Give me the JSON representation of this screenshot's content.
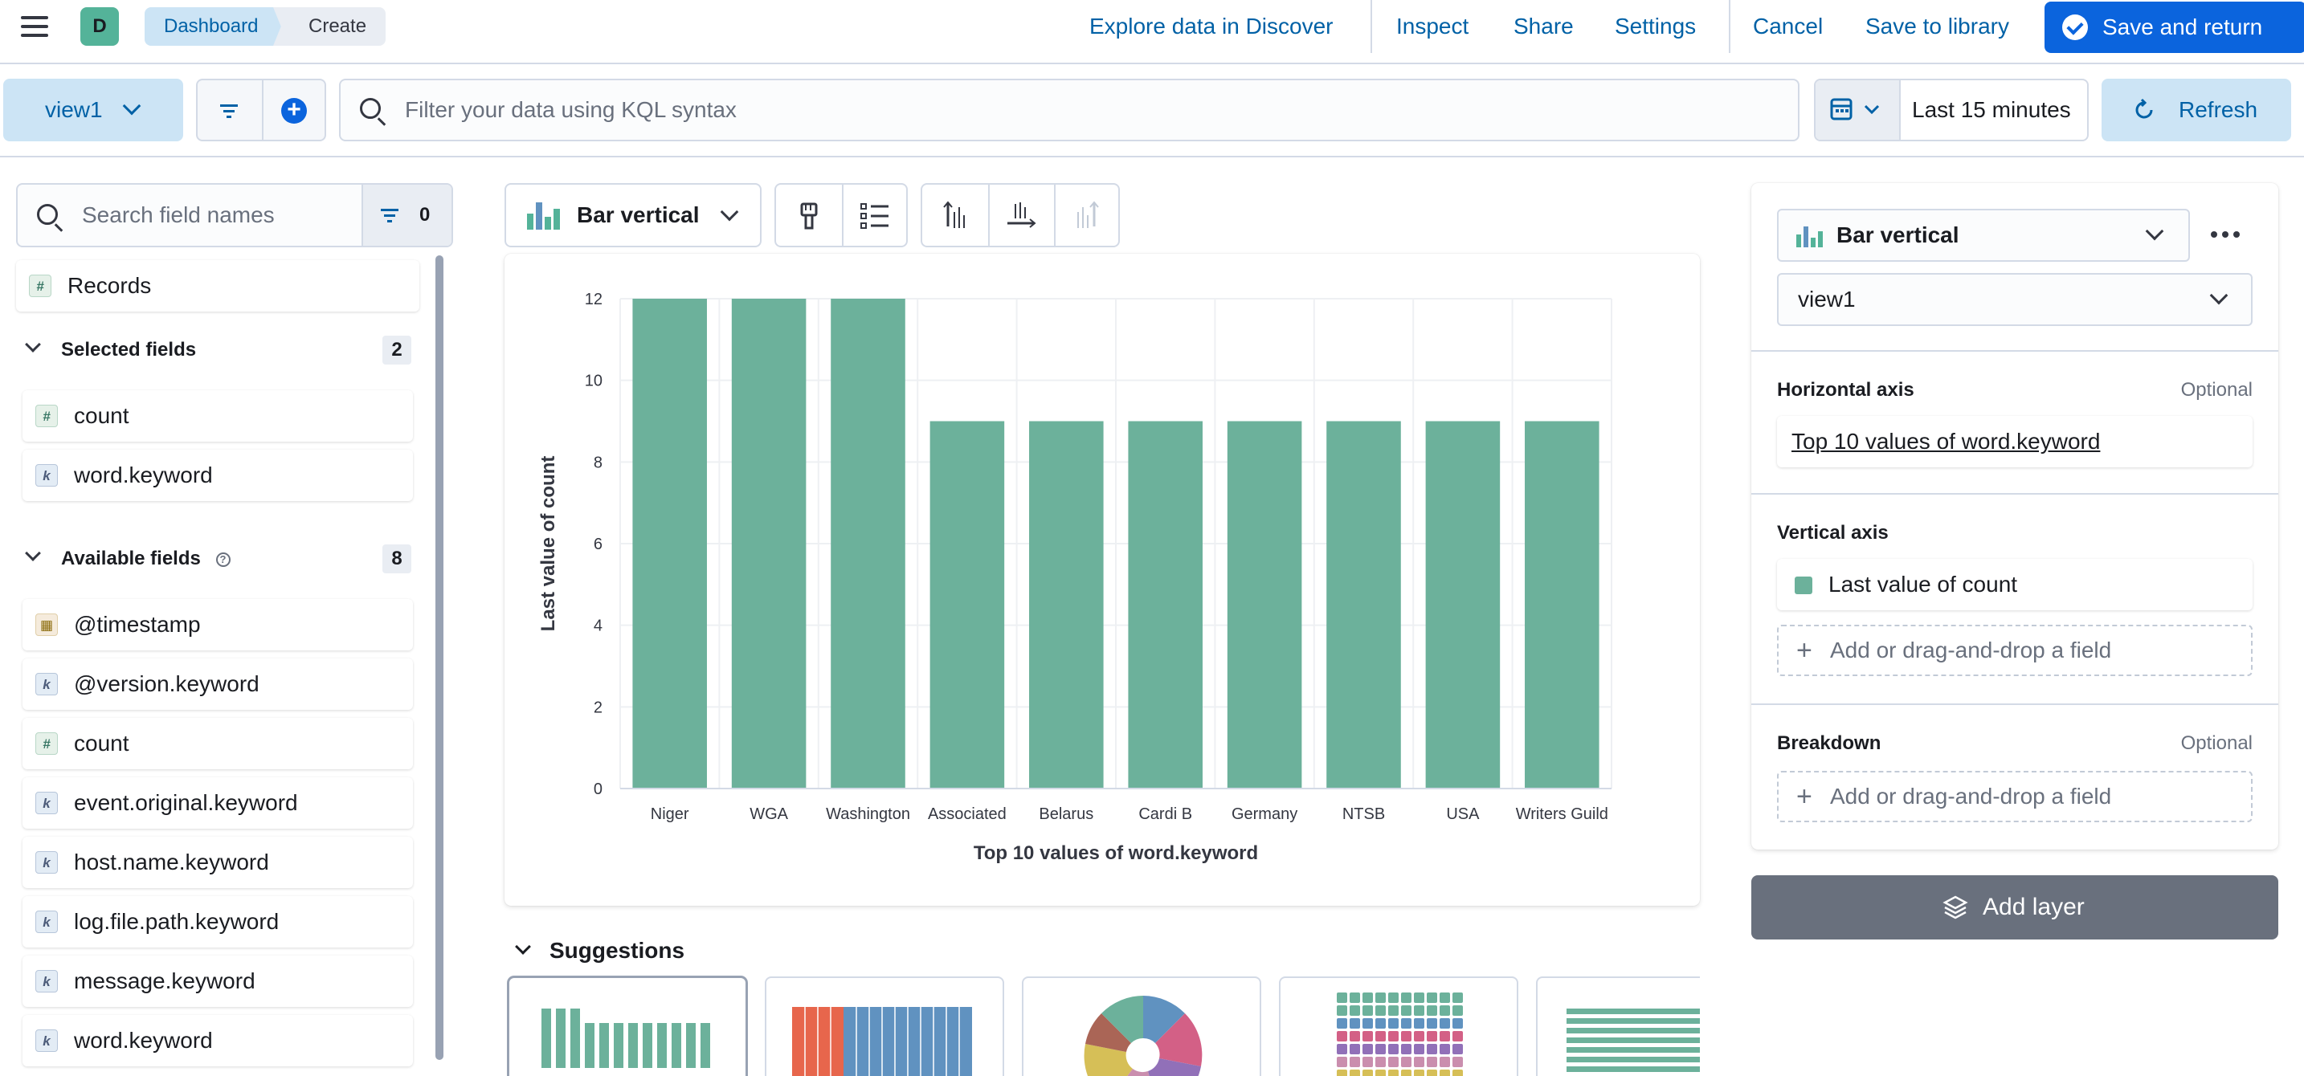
{
  "header": {
    "avatar_letter": "D",
    "breadcrumbs": [
      "Dashboard",
      "Create"
    ],
    "links": {
      "explore": "Explore data in Discover",
      "inspect": "Inspect",
      "share": "Share",
      "settings": "Settings",
      "cancel": "Cancel",
      "save_library": "Save to library"
    },
    "save_return_label": "Save and return"
  },
  "query": {
    "data_view": "view1",
    "kql_placeholder": "Filter your data using KQL syntax",
    "time_range": "Last 15 minutes",
    "refresh_label": "Refresh"
  },
  "fields": {
    "search_placeholder": "Search field names",
    "filter_count": "0",
    "records": {
      "type": "number",
      "label": "Records"
    },
    "selected": {
      "title": "Selected fields",
      "count": "2",
      "items": [
        {
          "type": "number",
          "label": "count"
        },
        {
          "type": "keyword",
          "label": "word.keyword"
        }
      ]
    },
    "available": {
      "title": "Available fields",
      "count": "8",
      "items": [
        {
          "type": "date",
          "label": "@timestamp"
        },
        {
          "type": "keyword",
          "label": "@version.keyword"
        },
        {
          "type": "number",
          "label": "count"
        },
        {
          "type": "keyword",
          "label": "event.original.keyword"
        },
        {
          "type": "keyword",
          "label": "host.name.keyword"
        },
        {
          "type": "keyword",
          "label": "log.file.path.keyword"
        },
        {
          "type": "keyword",
          "label": "message.keyword"
        },
        {
          "type": "keyword",
          "label": "word.keyword"
        }
      ]
    }
  },
  "workspace": {
    "vis_type": "Bar vertical",
    "suggestions_title": "Suggestions"
  },
  "chart_data": {
    "type": "bar",
    "categories": [
      "Niger",
      "WGA",
      "Washington",
      "Associated",
      "Belarus",
      "Cardi B",
      "Germany",
      "NTSB",
      "USA",
      "Writers Guild"
    ],
    "values": [
      12,
      12,
      12,
      9,
      9,
      9,
      9,
      9,
      9,
      9
    ],
    "xlabel": "Top 10 values of word.keyword",
    "ylabel": "Last value of count",
    "ylim": [
      0,
      12
    ],
    "yticks": [
      "0",
      "2",
      "4",
      "6",
      "8",
      "10",
      "12"
    ],
    "bar_color": "#6cb19b",
    "grid": true
  },
  "config": {
    "vis_type": "Bar vertical",
    "layer_data_view": "view1",
    "horizontal_axis": {
      "title": "Horizontal axis",
      "optional": "Optional",
      "value": "Top 10 values of word.keyword"
    },
    "vertical_axis": {
      "title": "Vertical axis",
      "value": "Last value of count",
      "dropzone": "Add or drag-and-drop a field"
    },
    "breakdown": {
      "title": "Breakdown",
      "optional": "Optional",
      "dropzone": "Add or drag-and-drop a field"
    },
    "add_layer": "Add layer"
  },
  "colors": {
    "accent": "#0b64dd",
    "accent_light": "#cce4f5",
    "bar": "#6cb19b",
    "text_link": "#0061a6"
  }
}
